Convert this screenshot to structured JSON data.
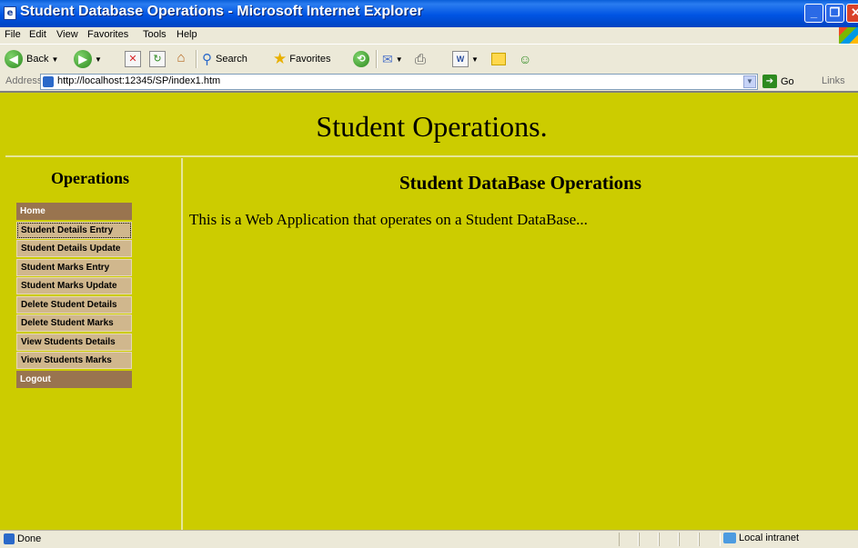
{
  "window": {
    "title": "Student Database Operations - Microsoft Internet Explorer",
    "app_icon": "ie-page-icon",
    "controls": {
      "minimize": "_",
      "maximize": "❐",
      "close": "✕"
    }
  },
  "menubar": {
    "items": [
      "File",
      "Edit",
      "View",
      "Favorites",
      "Tools",
      "Help"
    ]
  },
  "toolbar": {
    "back_label": "Back",
    "search_label": "Search",
    "favorites_label": "Favorites"
  },
  "address": {
    "label": "Address",
    "url": "http://localhost:12345/SP/index1.htm",
    "go_label": "Go",
    "links_label": "Links"
  },
  "page": {
    "banner_title": "Student Operations.",
    "sidebar_heading": "Operations",
    "menu": [
      {
        "label": "Home"
      },
      {
        "label": "Student Details Entry"
      },
      {
        "label": "Student Details Update"
      },
      {
        "label": "Student Marks Entry"
      },
      {
        "label": "Student Marks Update"
      },
      {
        "label": "Delete Student Details"
      },
      {
        "label": "Delete Student Marks"
      },
      {
        "label": "View Students Details"
      },
      {
        "label": "View Students Marks"
      },
      {
        "label": "Logout"
      }
    ],
    "main_heading": "Student DataBase Operations",
    "main_text": "This is a Web Application that operates on a Student DataBase..."
  },
  "statusbar": {
    "status": "Done",
    "zone": "Local intranet"
  },
  "colors": {
    "page_background": "#cccc00",
    "menu_dark": "#99744f",
    "menu_light": "#d0b78d",
    "titlebar": "#0054e3"
  }
}
